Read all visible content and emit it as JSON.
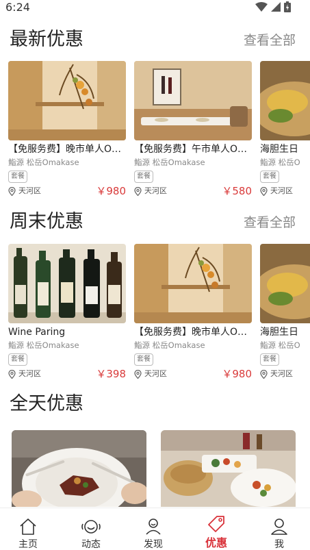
{
  "status": {
    "time": "6:24"
  },
  "sections": [
    {
      "title": "最新优惠",
      "see_all": "查看全部",
      "cards": [
        {
          "name": "【免服务费】晚市单人O…",
          "restaurant": "鮨源 松岳Omakase",
          "tag": "套餐",
          "district": "天河区",
          "price": "￥980"
        },
        {
          "name": "【免服务费】午市单人O…",
          "restaurant": "鮨源 松岳Omakase",
          "tag": "套餐",
          "district": "天河区",
          "price": "￥580"
        },
        {
          "name": "海胆生日",
          "restaurant": "鮨源 松岳O",
          "tag": "套餐",
          "district": "天河区",
          "price": ""
        }
      ]
    },
    {
      "title": "周末优惠",
      "see_all": "查看全部",
      "cards": [
        {
          "name": "Wine Paring",
          "restaurant": "鮨源 松岳Omakase",
          "tag": "套餐",
          "district": "天河区",
          "price": "￥398"
        },
        {
          "name": "【免服务费】晚市单人O…",
          "restaurant": "鮨源 松岳Omakase",
          "tag": "套餐",
          "district": "天河区",
          "price": "￥980"
        },
        {
          "name": "海胆生日",
          "restaurant": "鮨源 松岳O",
          "tag": "套餐",
          "district": "天河区",
          "price": ""
        }
      ]
    },
    {
      "title": "全天优惠"
    }
  ],
  "tabbar": [
    {
      "label": "主页",
      "icon": "home-icon"
    },
    {
      "label": "动态",
      "icon": "activity-icon"
    },
    {
      "label": "发现",
      "icon": "discover-icon"
    },
    {
      "label": "优惠",
      "icon": "coupon-icon",
      "active": true
    },
    {
      "label": "我",
      "icon": "profile-icon"
    }
  ],
  "colors": {
    "accent": "#d9323a",
    "price": "#d93a3a"
  }
}
